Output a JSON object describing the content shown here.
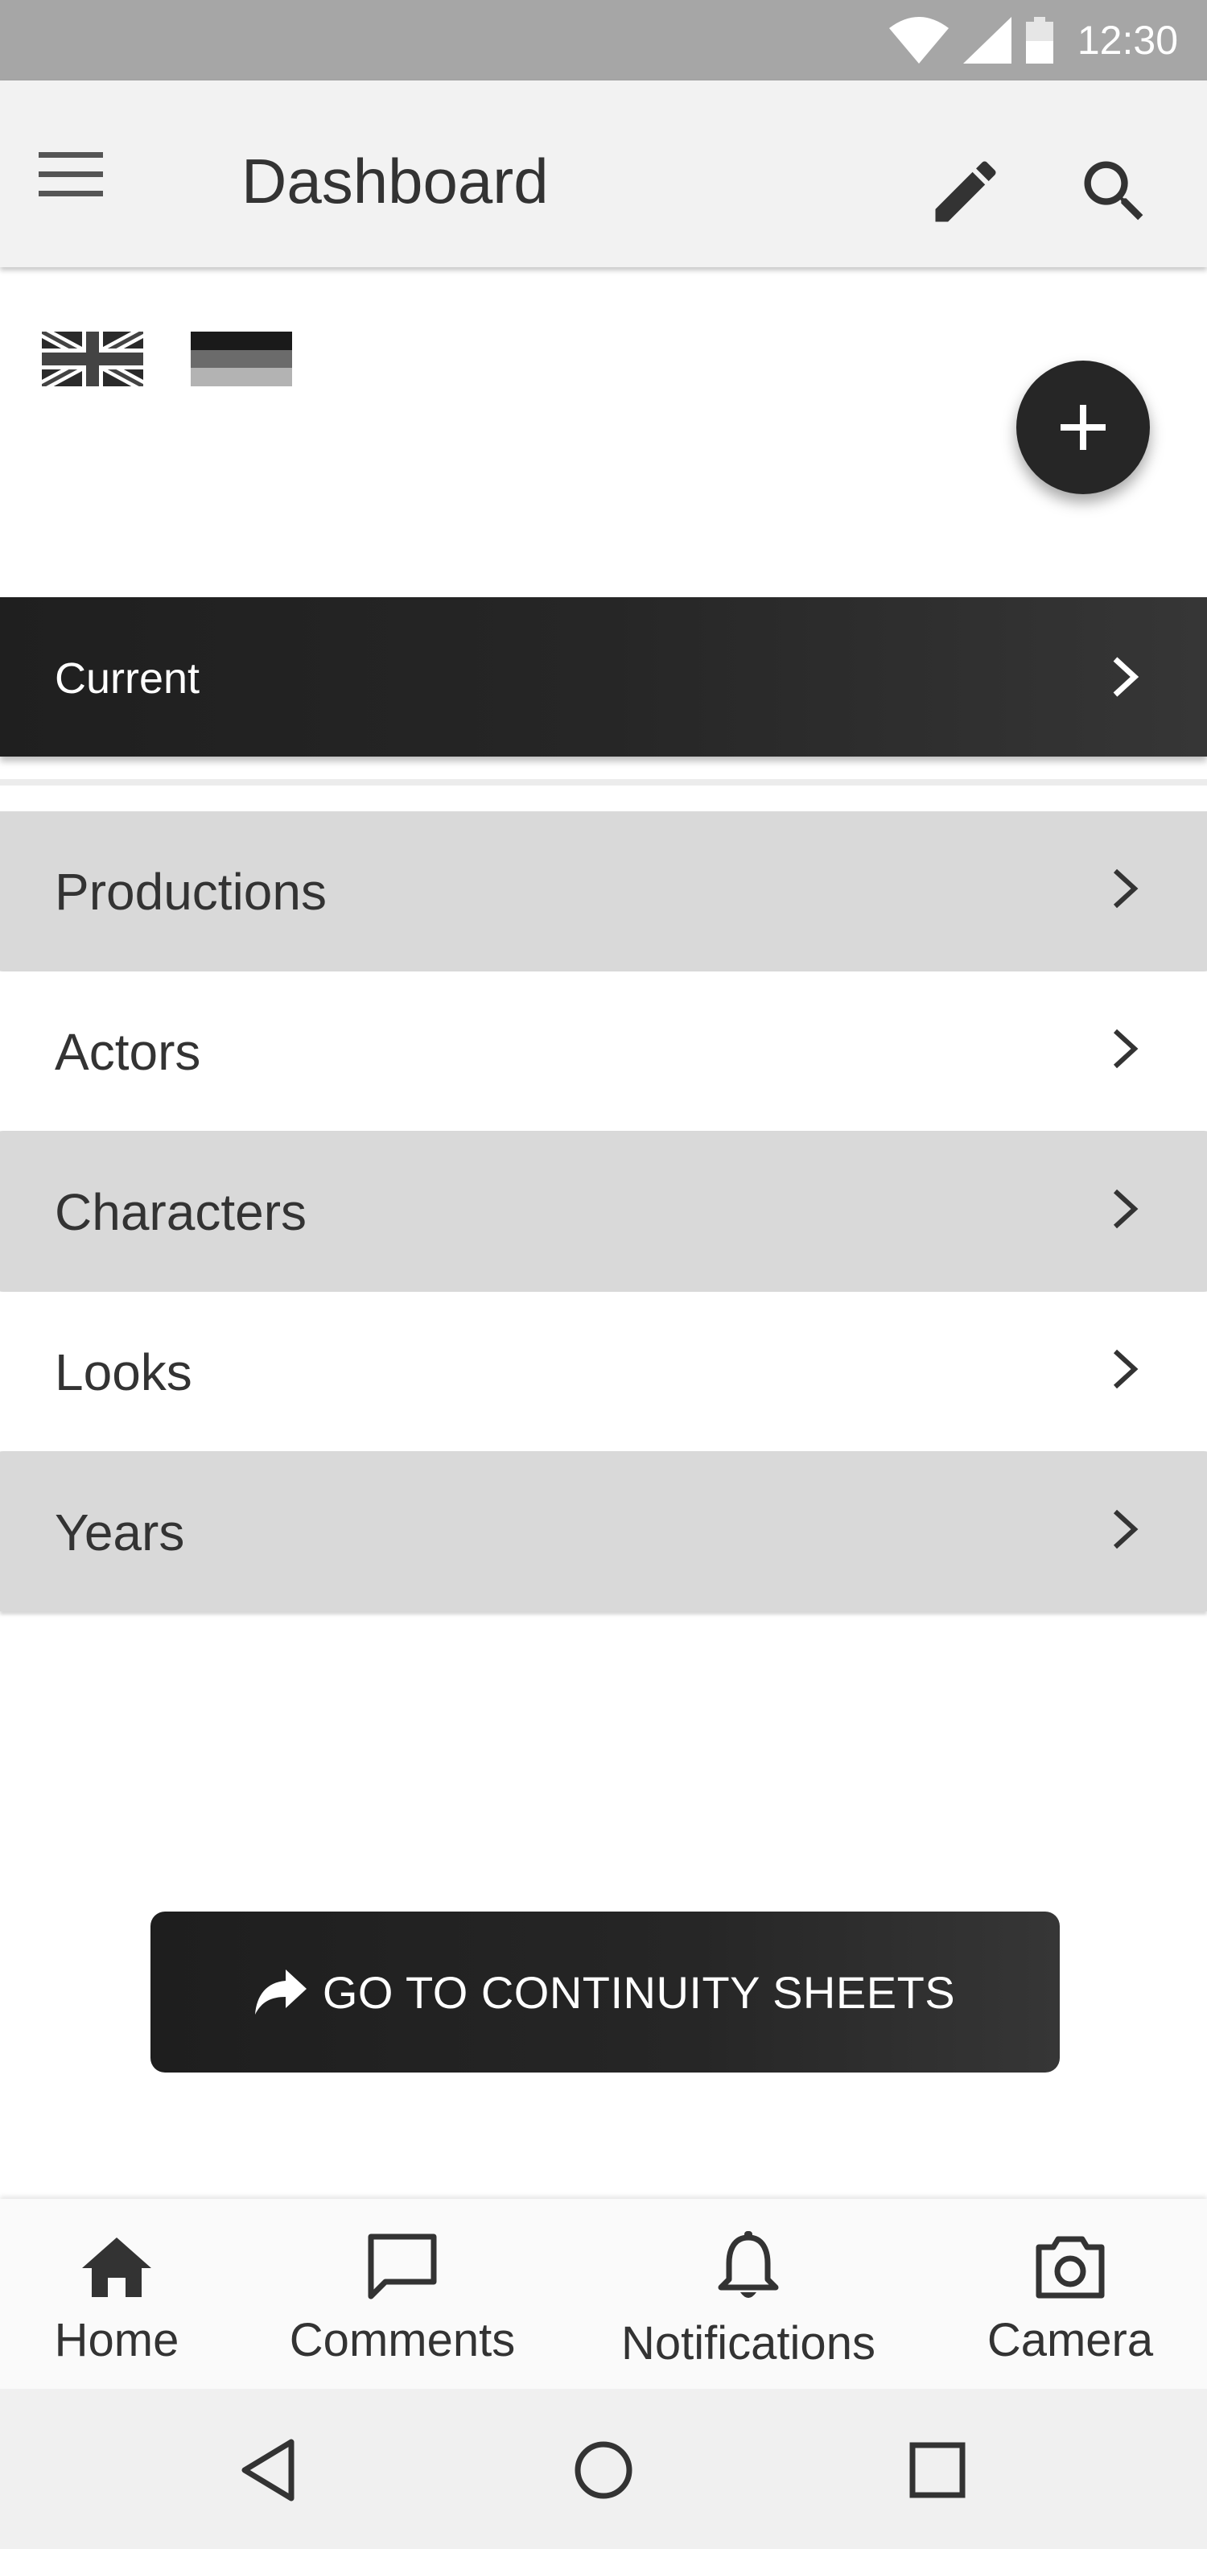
{
  "status_bar": {
    "time": "12:30",
    "icons": [
      "wifi-icon",
      "signal-icon",
      "battery-icon"
    ]
  },
  "app_bar": {
    "title": "Dashboard",
    "icons": [
      "menu-icon",
      "edit-icon",
      "search-icon"
    ]
  },
  "languages": [
    "uk-flag-icon",
    "de-flag-icon"
  ],
  "fab": {
    "icon": "plus-icon"
  },
  "current": {
    "label": "Current"
  },
  "list": {
    "items": [
      {
        "label": "Productions",
        "style": "grey"
      },
      {
        "label": "Actors",
        "style": "white"
      },
      {
        "label": "Characters",
        "style": "grey"
      },
      {
        "label": "Looks",
        "style": "white"
      },
      {
        "label": "Years",
        "style": "grey"
      }
    ]
  },
  "continuity_button": {
    "label": "GO TO CONTINUITY SHEETS",
    "icon": "share-arrow-icon"
  },
  "bottom_nav": {
    "items": [
      {
        "label": "Home",
        "icon": "home-icon"
      },
      {
        "label": "Comments",
        "icon": "comment-icon"
      },
      {
        "label": "Notifications",
        "icon": "bell-icon"
      },
      {
        "label": "Camera",
        "icon": "camera-icon"
      }
    ]
  },
  "system_nav": [
    "back-icon",
    "home-circle-icon",
    "recents-icon"
  ],
  "colors": {
    "status_bar": "#a6a6a6",
    "app_bar": "#f2f2f2",
    "dark": "#262626",
    "row_grey": "#d9d9d9",
    "text": "#333333"
  }
}
